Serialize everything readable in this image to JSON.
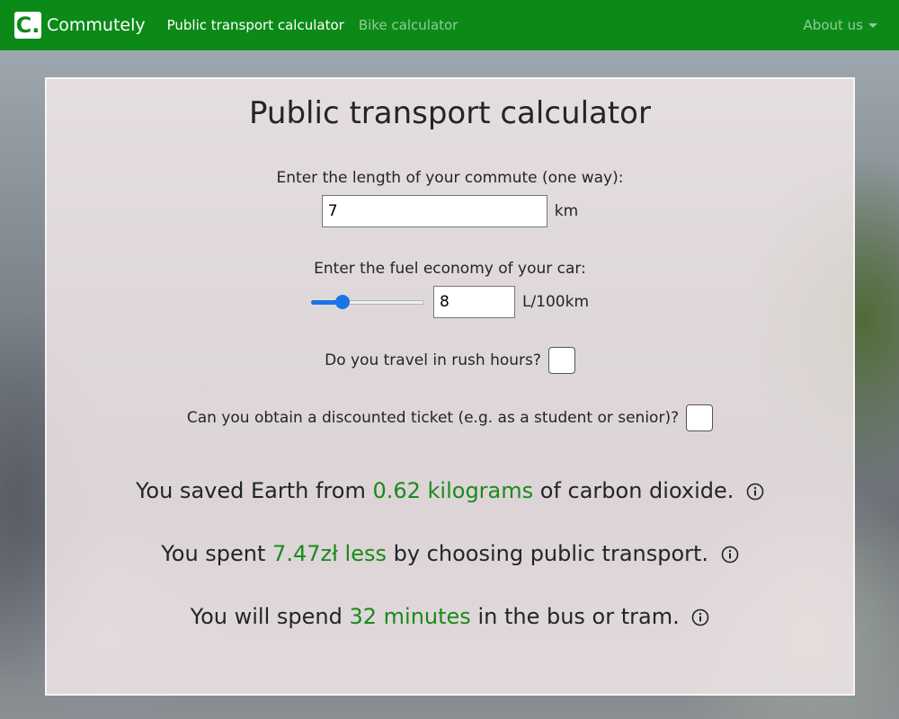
{
  "navbar": {
    "brand_letter": "C.",
    "brand_name": "Commutely",
    "links": [
      {
        "label": "Public transport calculator",
        "active": true
      },
      {
        "label": "Bike calculator",
        "active": false
      }
    ],
    "about_label": "About us"
  },
  "card": {
    "title": "Public transport calculator",
    "commute": {
      "label": "Enter the length of your commute (one way):",
      "value": "7",
      "unit": "km"
    },
    "fuel": {
      "label": "Enter the fuel economy of your car:",
      "slider_level": 0.28,
      "value": "8",
      "unit": "L/100km"
    },
    "rush_hours": {
      "label": "Do you travel in rush hours?",
      "checked": false
    },
    "discount": {
      "label": "Can you obtain a discounted ticket (e.g. as a student or senior)?",
      "checked": false
    },
    "results": [
      {
        "before": "You saved Earth from ",
        "highlight": "0.62 kilograms",
        "after": " of carbon dioxide."
      },
      {
        "before": "You spent ",
        "highlight": "7.47zł less",
        "after": " by choosing public transport."
      },
      {
        "before": "You will spend ",
        "highlight": "32 minutes",
        "after": " in the bus or tram."
      }
    ]
  },
  "colors": {
    "navbar": "#0c8a18",
    "highlight": "#1a8a1a",
    "slider": "#1a73e8"
  }
}
